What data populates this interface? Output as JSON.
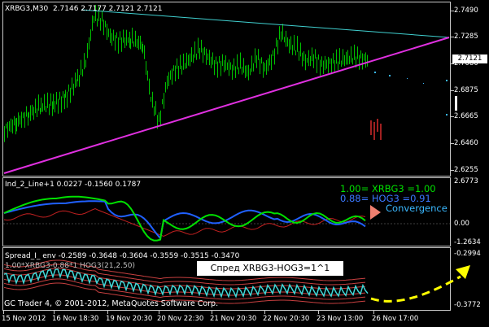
{
  "chart": {
    "symbol_label": "XRBG3,M30",
    "ohlc": "2.7146 2.7177 2.7121 2.7121",
    "current_price": "2.7121",
    "price_axis": [
      "2.7490",
      "2.7285",
      "2.7080",
      "2.6875",
      "2.6665",
      "2.6460",
      "2.6255"
    ]
  },
  "indicator": {
    "label": "Ind_2_Line+1 0.0227 -0.1560 0.1787",
    "axis": [
      "2.6773",
      "0.00",
      "-1.2634"
    ],
    "ratio_line_1": "1.00= XRBG3 =1.00",
    "ratio_line_2": "0.88= HOG3 =0.91",
    "convergence": "Convergence"
  },
  "spread": {
    "label": "Spread_I_ env -0.2589 -0.3648 -0.3604 -0.3559 -0.3515 -0.3470",
    "sub_label": "1.00*XRBG3-0.88*1 HOG3(21,2.50)",
    "axis": [
      "-0.2994",
      "-0.3772"
    ],
    "box_text": "Спред XRBG3-HOG3=1^1"
  },
  "footer": {
    "copyright": "GC Trader 4, © 2001-2012, MetaQuotes Software Corp."
  },
  "time_axis": [
    "15 Nov 2012",
    "16 Nov 18:30",
    "19 Nov 20:30",
    "20 Nov 22:30",
    "21 Nov 20:30",
    "22 Nov 20:30",
    "23 Nov 13:00",
    "26 Nov 17:00"
  ],
  "colors": {
    "background": "#000000",
    "candles": "#00c000",
    "trendline_upper": "#40d0d0",
    "trendline_lower": "#e030e0",
    "ind_green": "#00e000",
    "ind_blue": "#2060ff",
    "ind_red": "#c02020",
    "spread_main": "#40d8d8",
    "envelope": "#c84040",
    "arrow_yellow": "#ffff00",
    "convergence_marker": "#f08070"
  }
}
